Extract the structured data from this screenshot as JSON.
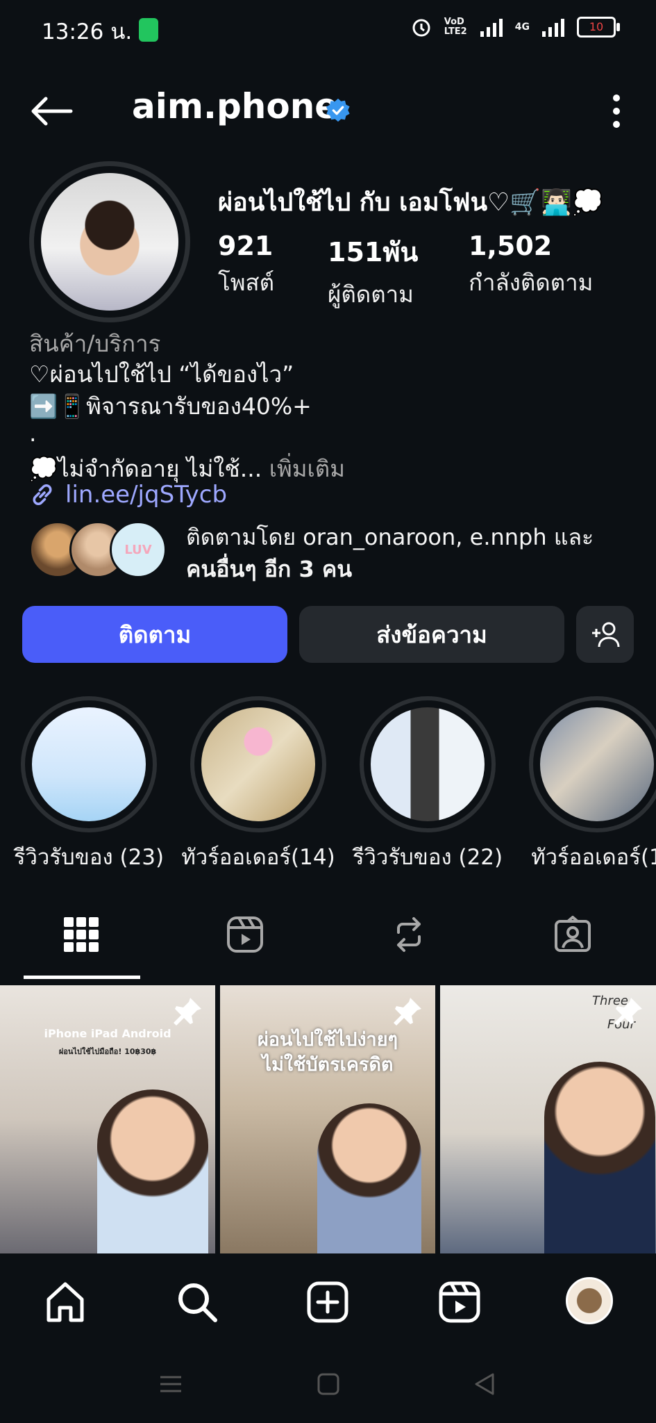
{
  "status_bar": {
    "time": "13:26 น.",
    "battery": "10",
    "network": "4G",
    "volte": "VoD LTE2"
  },
  "header": {
    "username": "aim.phone",
    "back_icon": "back-arrow-icon",
    "verified_icon": "verified-badge-icon",
    "more_icon": "more-vertical-icon"
  },
  "profile": {
    "display_name": "ผ่อนไปใช้ไป กับ เอมโฟน♡🛒👨🏻‍💻💭",
    "stats": [
      {
        "value": "921",
        "label": "โพสต์"
      },
      {
        "value": "151พัน",
        "label": "ผู้ติดตาม"
      },
      {
        "value": "1,502",
        "label": "กำลังติดตาม"
      }
    ],
    "category": "สินค้า/บริการ",
    "bio_lines": [
      "♡ผ่อนไปใช้ไป “ได้ของไว”",
      "➡️📱พิจารณารับของ40%+",
      ".",
      "💭ไม่จำกัดอายุ ไม่ใช้..."
    ],
    "more_label": "เพิ่มเติม",
    "link": "lin.ee/jqSTycb",
    "followed_by_prefix": "ติดตามโดย ",
    "followed_by_names": "oran_onaroon, e.nnph",
    "followed_by_and": " และ",
    "followed_by_others": "คนอื่นๆ อีก 3 คน"
  },
  "actions": {
    "follow": "ติดตาม",
    "message": "ส่งข้อความ"
  },
  "highlights": [
    {
      "label": "รีวิวรับของ (23)"
    },
    {
      "label": "ทัวร์ออเดอร์(14)"
    },
    {
      "label": "รีวิวรับของ (22)"
    },
    {
      "label": "ทัวร์ออเดอร์(1"
    }
  ],
  "tabs": [
    "grid-icon",
    "reels-icon",
    "reposts-icon",
    "tagged-icon"
  ],
  "posts": [
    {
      "text_line1": "iPhone iPad Android",
      "text_line2": "ผ่อนไปใช้ไปมือถือ! 10฿30฿"
    },
    {
      "text_line1": "ผ่อนไปใช้ไปง่ายๆ",
      "text_line2": "ไม่ใช้บัตรเครดิต"
    },
    {
      "text_line1": "Three",
      "text_line2": "Four"
    }
  ],
  "bottom_nav": [
    "home-icon",
    "search-icon",
    "create-icon",
    "reels-icon",
    "profile-avatar"
  ],
  "colors": {
    "background": "#0c1014",
    "follow_button": "#4a5df9",
    "secondary_button": "#25292e",
    "link": "#9ea8ff",
    "verified": "#3897f0",
    "muted": "#a8a8a8"
  }
}
